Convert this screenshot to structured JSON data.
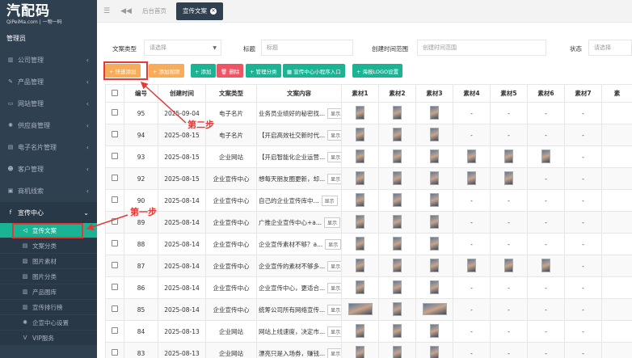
{
  "sidebar": {
    "logo_text": "汽配码",
    "logo_subtext": "QiPeiMa.com | 一物一码",
    "role": "管理员",
    "menu": [
      {
        "label": "公司管理",
        "icon": "bank-icon"
      },
      {
        "label": "产品管理",
        "icon": "wrench-icon"
      },
      {
        "label": "网站管理",
        "icon": "monitor-icon"
      },
      {
        "label": "供应商管理",
        "icon": "gear-icon"
      },
      {
        "label": "电子名片管理",
        "icon": "card-icon"
      },
      {
        "label": "客户管理",
        "icon": "users-icon"
      },
      {
        "label": "商机线索",
        "icon": "bag-icon"
      },
      {
        "label": "宣传中心",
        "icon": "facebook-icon"
      }
    ],
    "submenu": [
      {
        "label": "宣传文案"
      },
      {
        "label": "文案分类"
      },
      {
        "label": "图片素材"
      },
      {
        "label": "图片分类"
      },
      {
        "label": "产品图库"
      },
      {
        "label": "宣传排行榜"
      },
      {
        "label": "企宣中心设置"
      },
      {
        "label": "VIP服务"
      }
    ]
  },
  "topbar": {
    "tabs": [
      {
        "label": "后台首页"
      },
      {
        "label": "宣传文案"
      }
    ]
  },
  "filters": {
    "type_label": "文案类型",
    "type_value": "请选择",
    "title_label": "标题",
    "title_placeholder": "标题",
    "created_label": "创建时间范围",
    "created_placeholder": "创建时间范围",
    "status_label": "状态",
    "status_value": "请选择"
  },
  "toolbar": {
    "buttons": [
      {
        "label": "+ 快速添加",
        "color": "#f8ac59"
      },
      {
        "label": "+ 添加视频",
        "color": "#f8ac59"
      },
      {
        "label": "+ 添加",
        "color": "#1ab394"
      },
      {
        "label": "🗑 删除",
        "color": "#ed5565"
      },
      {
        "label": "+ 管理分类",
        "color": "#1ab394"
      },
      {
        "label": "▦ 宣传中心小程序入口",
        "color": "#1ab394"
      },
      {
        "label": "+ 海报LOGO设置",
        "color": "#1ab394"
      }
    ]
  },
  "table": {
    "headers": [
      "编号",
      "创建时间",
      "文案类型",
      "文案内容",
      "素材1",
      "素材2",
      "素材3",
      "素材4",
      "素材5",
      "素材6",
      "素材7",
      "素"
    ],
    "show_label": "显示",
    "rows": [
      {
        "id": "95",
        "date": "2025-09-04",
        "type": "电子名片",
        "content": "业务员业绩好的秘密找...",
        "m": [
          1,
          1,
          1,
          0,
          0,
          0,
          0
        ]
      },
      {
        "id": "94",
        "date": "2025-08-15",
        "type": "电子名片",
        "content": "【开启高效社交新时代...",
        "m": [
          1,
          1,
          1,
          0,
          0,
          0,
          0
        ]
      },
      {
        "id": "93",
        "date": "2025-08-15",
        "type": "企业网站",
        "content": "【开启智能化企业运营...",
        "m": [
          1,
          1,
          1,
          1,
          1,
          1,
          0
        ]
      },
      {
        "id": "92",
        "date": "2025-08-15",
        "type": "企业宣传中心",
        "content": "想每天朋友圈更新，却...",
        "m": [
          1,
          1,
          1,
          1,
          1,
          0,
          0
        ]
      },
      {
        "id": "90",
        "date": "2025-08-14",
        "type": "企业宣传中心",
        "content": "自己的企业宣传库中...",
        "m": [
          1,
          1,
          1,
          0,
          0,
          0,
          0
        ]
      },
      {
        "id": "89",
        "date": "2025-08-14",
        "type": "企业宣传中心",
        "content": "广推企业宣传中心+a...",
        "m": [
          1,
          1,
          1,
          0,
          0,
          0,
          0
        ]
      },
      {
        "id": "88",
        "date": "2025-08-14",
        "type": "企业宣传中心",
        "content": "企业宣传素材不够？a...",
        "m": [
          1,
          1,
          1,
          0,
          0,
          0,
          0
        ]
      },
      {
        "id": "87",
        "date": "2025-08-14",
        "type": "企业宣传中心",
        "content": "企业宣传的素材不够多...",
        "m": [
          1,
          1,
          1,
          1,
          1,
          1,
          0
        ]
      },
      {
        "id": "86",
        "date": "2025-08-14",
        "type": "企业宣传中心",
        "content": "企业宣传中心，更适合...",
        "m": [
          1,
          1,
          1,
          0,
          0,
          0,
          0
        ]
      },
      {
        "id": "85",
        "date": "2025-08-14",
        "type": "企业宣传中心",
        "content": "统筹公司所有网络宣传...",
        "m": [
          2,
          1,
          2,
          0,
          0,
          0,
          0
        ]
      },
      {
        "id": "84",
        "date": "2025-08-13",
        "type": "企业网站",
        "content": "网站上线速度，决定市...",
        "m": [
          1,
          1,
          1,
          0,
          0,
          0,
          0
        ]
      },
      {
        "id": "83",
        "date": "2025-08-13",
        "type": "企业网站",
        "content": "漂亮只是入场券，赚钱...",
        "m": [
          1,
          1,
          1,
          0,
          0,
          0,
          0
        ]
      }
    ]
  },
  "annotations": {
    "step1": "第一步",
    "step2": "第二步",
    "color": "#e53935"
  }
}
